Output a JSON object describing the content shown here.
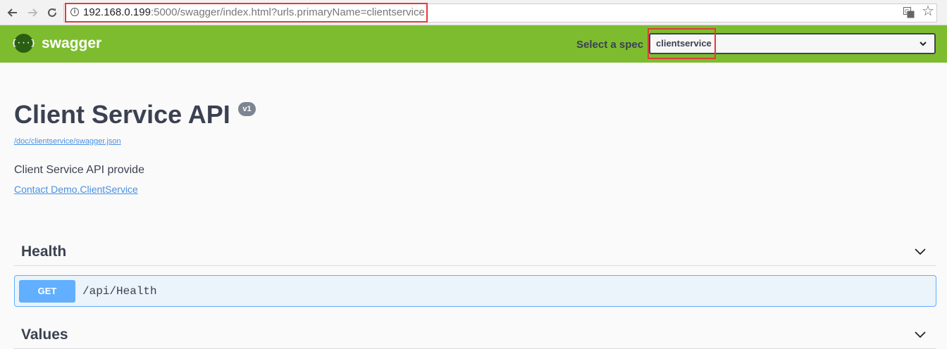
{
  "browser": {
    "url_host": "192.168.0.199",
    "url_rest": ":5000/swagger/index.html?urls.primaryName=clientservice"
  },
  "topbar": {
    "logo_mark": "{···}",
    "logo_text": "swagger",
    "spec_label": "Select a spec",
    "spec_value": "clientservice",
    "color": "#7dbc2f"
  },
  "info": {
    "title": "Client Service API",
    "version": "v1",
    "spec_url": "/doc/clientservice/swagger.json",
    "description": "Client Service API provide",
    "contact": "Contact Demo.ClientService"
  },
  "tags": [
    {
      "name": "Health",
      "operations": [
        {
          "method": "GET",
          "path": "/api/Health"
        }
      ]
    },
    {
      "name": "Values"
    }
  ],
  "colors": {
    "get_method": "#61affe",
    "highlight": "#e23b3b"
  }
}
